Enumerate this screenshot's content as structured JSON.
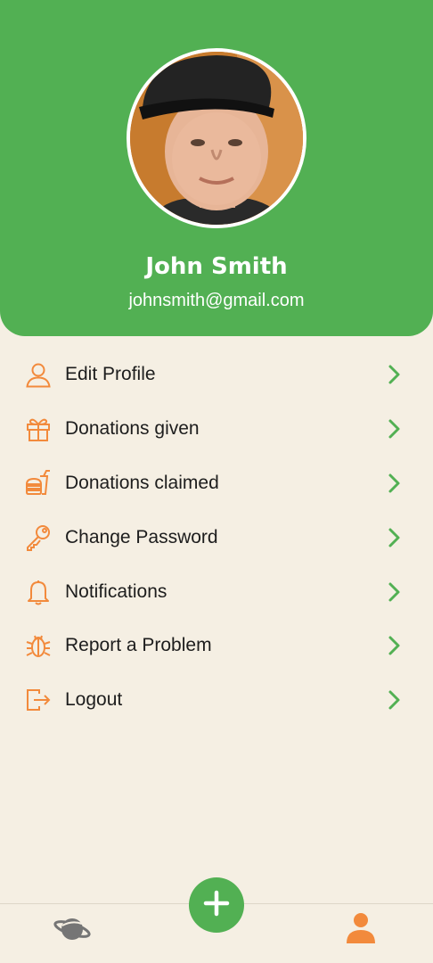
{
  "profile": {
    "name": "John Smith",
    "email": "johnsmith@gmail.com"
  },
  "menu": {
    "items": [
      {
        "label": "Edit Profile",
        "icon": "user-icon"
      },
      {
        "label": "Donations given",
        "icon": "gift-icon"
      },
      {
        "label": "Donations claimed",
        "icon": "food-icon"
      },
      {
        "label": "Change Password",
        "icon": "key-icon"
      },
      {
        "label": "Notifications",
        "icon": "bell-icon"
      },
      {
        "label": "Report a Problem",
        "icon": "bug-icon"
      },
      {
        "label": "Logout",
        "icon": "logout-icon"
      }
    ]
  },
  "nav": {
    "items": [
      {
        "name": "explore",
        "icon": "planet-icon",
        "active": false
      },
      {
        "name": "add",
        "icon": "plus-icon"
      },
      {
        "name": "profile",
        "icon": "person-icon",
        "active": true
      }
    ]
  },
  "colors": {
    "primary_green": "#52b053",
    "accent_orange": "#f28a3c",
    "background": "#f5efe3",
    "inactive_icon": "#757575"
  }
}
